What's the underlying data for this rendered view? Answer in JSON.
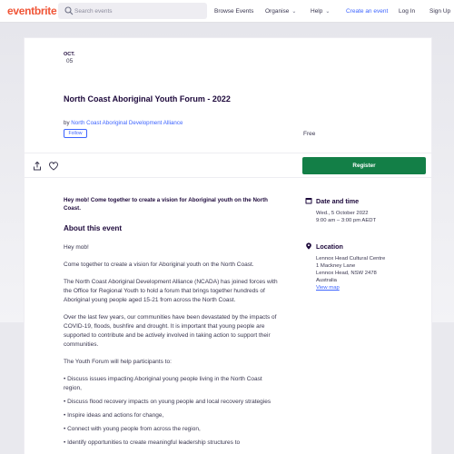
{
  "nav": {
    "logo": "eventbrite",
    "search_placeholder": "Search events",
    "browse_events": "Browse Events",
    "organise": "Organise",
    "help": "Help",
    "create_event": "Create an event",
    "log_in": "Log In",
    "sign_up": "Sign Up"
  },
  "event": {
    "date_month": "OCT.",
    "date_day": "05",
    "title": "North Coast Aboriginal Youth Forum - 2022",
    "by_prefix": "by",
    "organizer": "North Coast Aboriginal Development Alliance",
    "follow_label": "Follow",
    "price": "Free",
    "register_label": "Register"
  },
  "content": {
    "summary": "Hey mob! Come together to create a vision for Aboriginal youth on the North Coast.",
    "about_heading": "About this event",
    "paragraphs": [
      "Hey mob!",
      "Come together to create a vision for Aboriginal youth on the North Coast.",
      "The North Coast Aboriginal Development Alliance (NCADA) has joined forces with the Office for Regional Youth to hold a forum that brings together hundreds of Aboriginal young people aged 15-21 from across the North Coast.",
      "Over the last few years, our communities have been devastated by the impacts of COVID-19, floods, bushfire and drought. It is important that young people are supported to contribute and be actively involved in taking action to support their communities.",
      "The Youth Forum will help participants to:",
      "• Discuss issues impacting Aboriginal young people living in the North Coast region,",
      "• Discuss flood recovery impacts on young people and local recovery strategies",
      "• Inspire ideas and actions for change,",
      "• Connect with young people from across the region,",
      "• Identify opportunities to create meaningful leadership structures to"
    ]
  },
  "sidebar": {
    "date_heading": "Date and time",
    "date_line": "Wed., 5 October 2022",
    "time_line": "9:00 am – 3:00 pm AEDT",
    "location_heading": "Location",
    "venue": "Lennox Head Cultural Centre",
    "street": "1 Mackney Lane",
    "city": "Lennox Head, NSW 2478",
    "country": "Australia",
    "view_map": "View map"
  },
  "colors": {
    "brand": "#f05537",
    "link": "#3d64ff",
    "register": "#137f47",
    "heading": "#1e0a3c"
  }
}
